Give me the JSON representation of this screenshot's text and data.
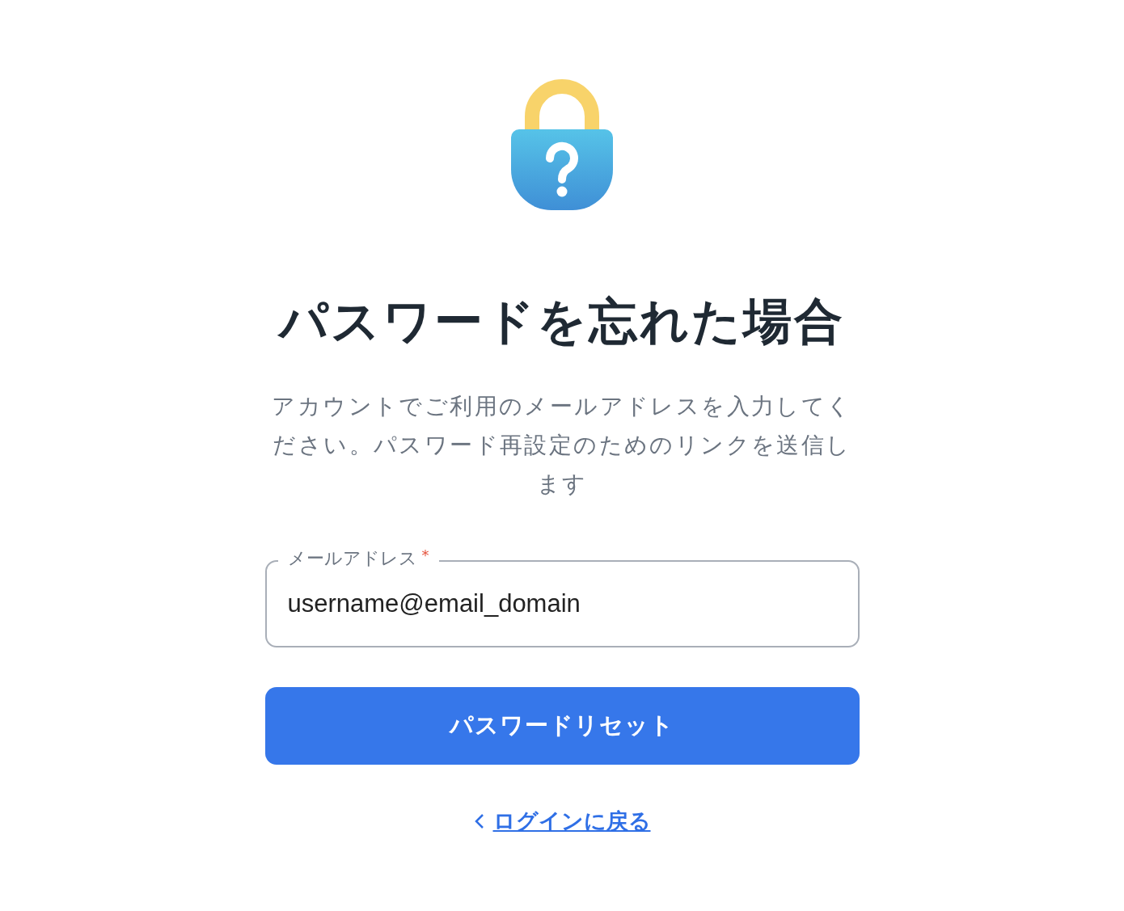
{
  "title": "パスワードを忘れた場合",
  "description": "アカウントでご利用のメールアドレスを入力してください。パスワード再設定のためのリンクを送信します",
  "email_field": {
    "label": "メールアドレス",
    "required_mark": "*",
    "value": "username@email_domain"
  },
  "submit_button": {
    "label": "パスワードリセット"
  },
  "back_link": {
    "label": "ログインに戻る"
  }
}
